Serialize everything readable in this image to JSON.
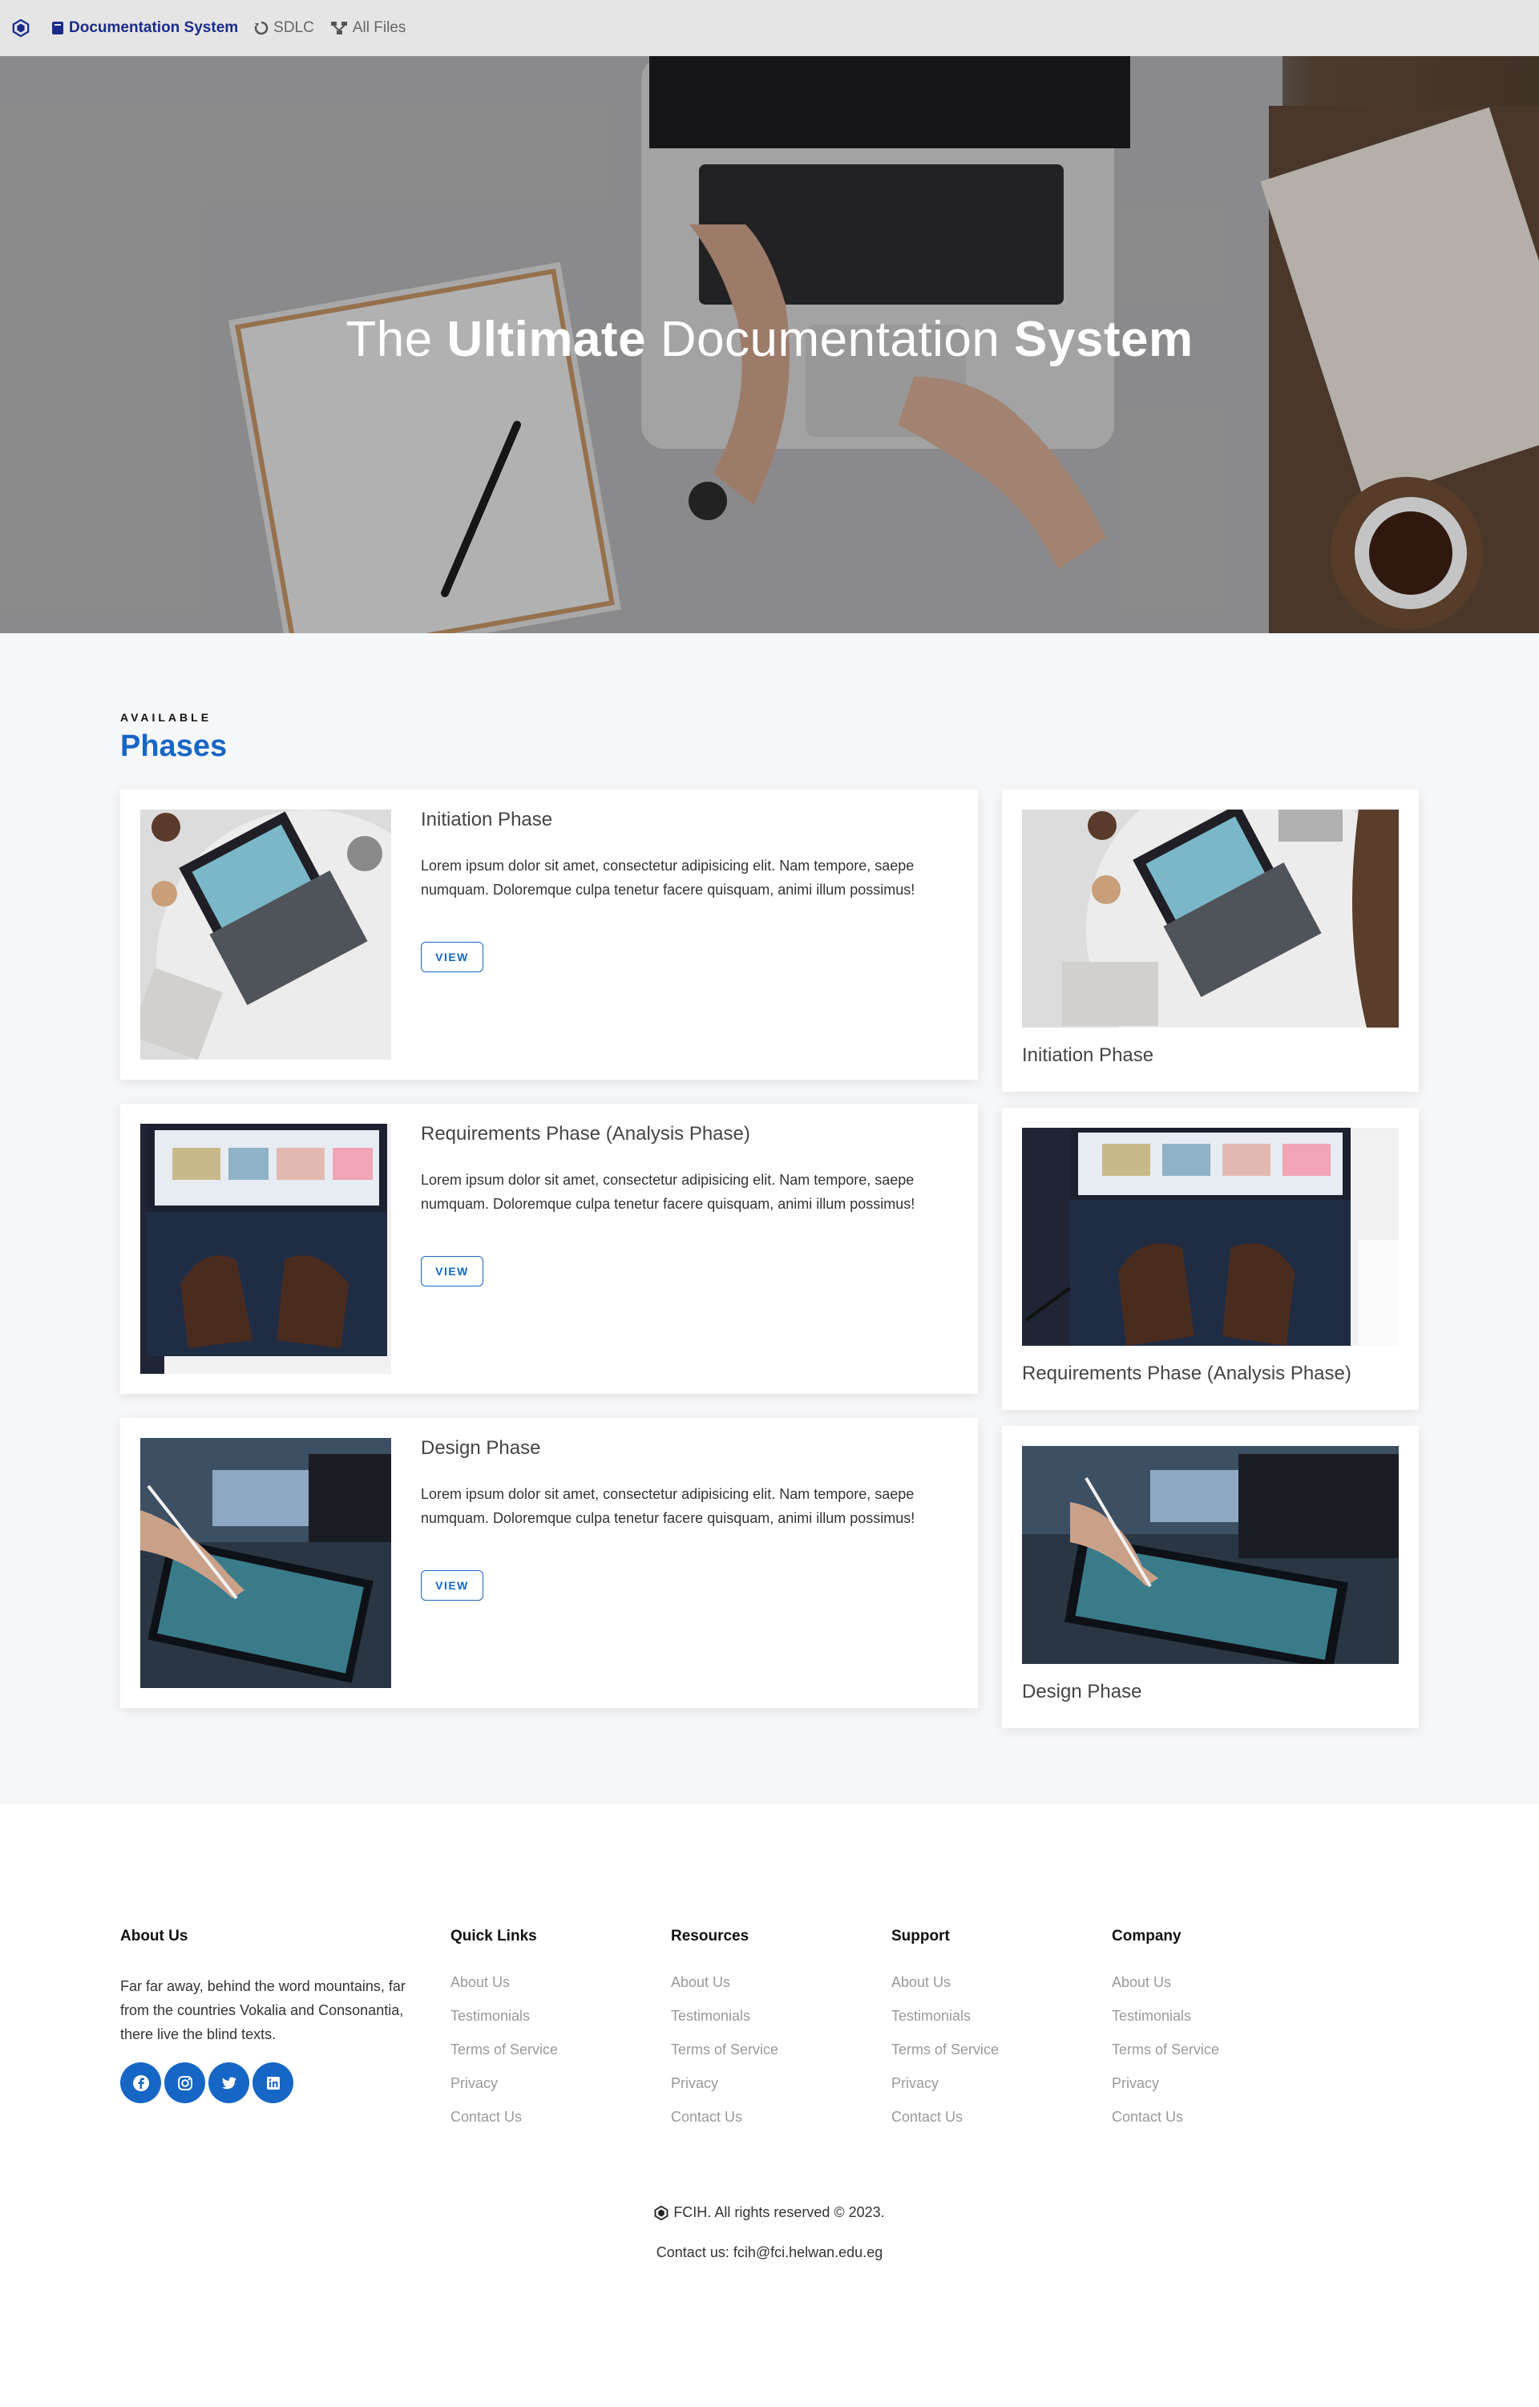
{
  "navbar": {
    "brand_label": "Documentation System",
    "links": [
      {
        "label": "SDLC",
        "icon": "recycle-icon"
      },
      {
        "label": "All Files",
        "icon": "sitemap-icon"
      }
    ]
  },
  "hero": {
    "title_part1": "The ",
    "title_bold1": "Ultimate",
    "title_part2": " Documentation ",
    "title_bold2": "System"
  },
  "phases": {
    "kicker": "AVAILABLE",
    "title": "Phases",
    "view_label": "VIEW",
    "items": [
      {
        "title": "Initiation Phase",
        "description": "Lorem ipsum dolor sit amet, consectetur adipisicing elit. Nam tempore, saepe numquam. Doloremque culpa tenetur facere quisquam, animi illum possimus!"
      },
      {
        "title": "Requirements Phase (Analysis Phase)",
        "description": "Lorem ipsum dolor sit amet, consectetur adipisicing elit. Nam tempore, saepe numquam. Doloremque culpa tenetur facere quisquam, animi illum possimus!"
      },
      {
        "title": "Design Phase",
        "description": "Lorem ipsum dolor sit amet, consectetur adipisicing elit. Nam tempore, saepe numquam. Doloremque culpa tenetur facere quisquam, animi illum possimus!"
      }
    ]
  },
  "footer": {
    "about": {
      "title": "About Us",
      "text": "Far far away, behind the word mountains, far from the countries Vokalia and Consonantia, there live the blind texts.",
      "socials": [
        "facebook-icon",
        "instagram-icon",
        "twitter-icon",
        "linkedin-icon"
      ]
    },
    "columns": [
      {
        "title": "Quick Links",
        "links": [
          "About Us",
          "Testimonials",
          "Terms of Service",
          "Privacy",
          "Contact Us"
        ]
      },
      {
        "title": "Resources",
        "links": [
          "About Us",
          "Testimonials",
          "Terms of Service",
          "Privacy",
          "Contact Us"
        ]
      },
      {
        "title": "Support",
        "links": [
          "About Us",
          "Testimonials",
          "Terms of Service",
          "Privacy",
          "Contact Us"
        ]
      },
      {
        "title": "Company",
        "links": [
          "About Us",
          "Testimonials",
          "Terms of Service",
          "Privacy",
          "Contact Us"
        ]
      }
    ],
    "copyright": "FCIH. All rights reserved © 2023.",
    "contact": "Contact us: fcih@fci.helwan.edu.eg"
  },
  "colors": {
    "accent": "#1666c5",
    "brand": "#1a2b8c",
    "navbar_bg": "#e5e5e5",
    "section_bg": "#f6f7f9"
  }
}
